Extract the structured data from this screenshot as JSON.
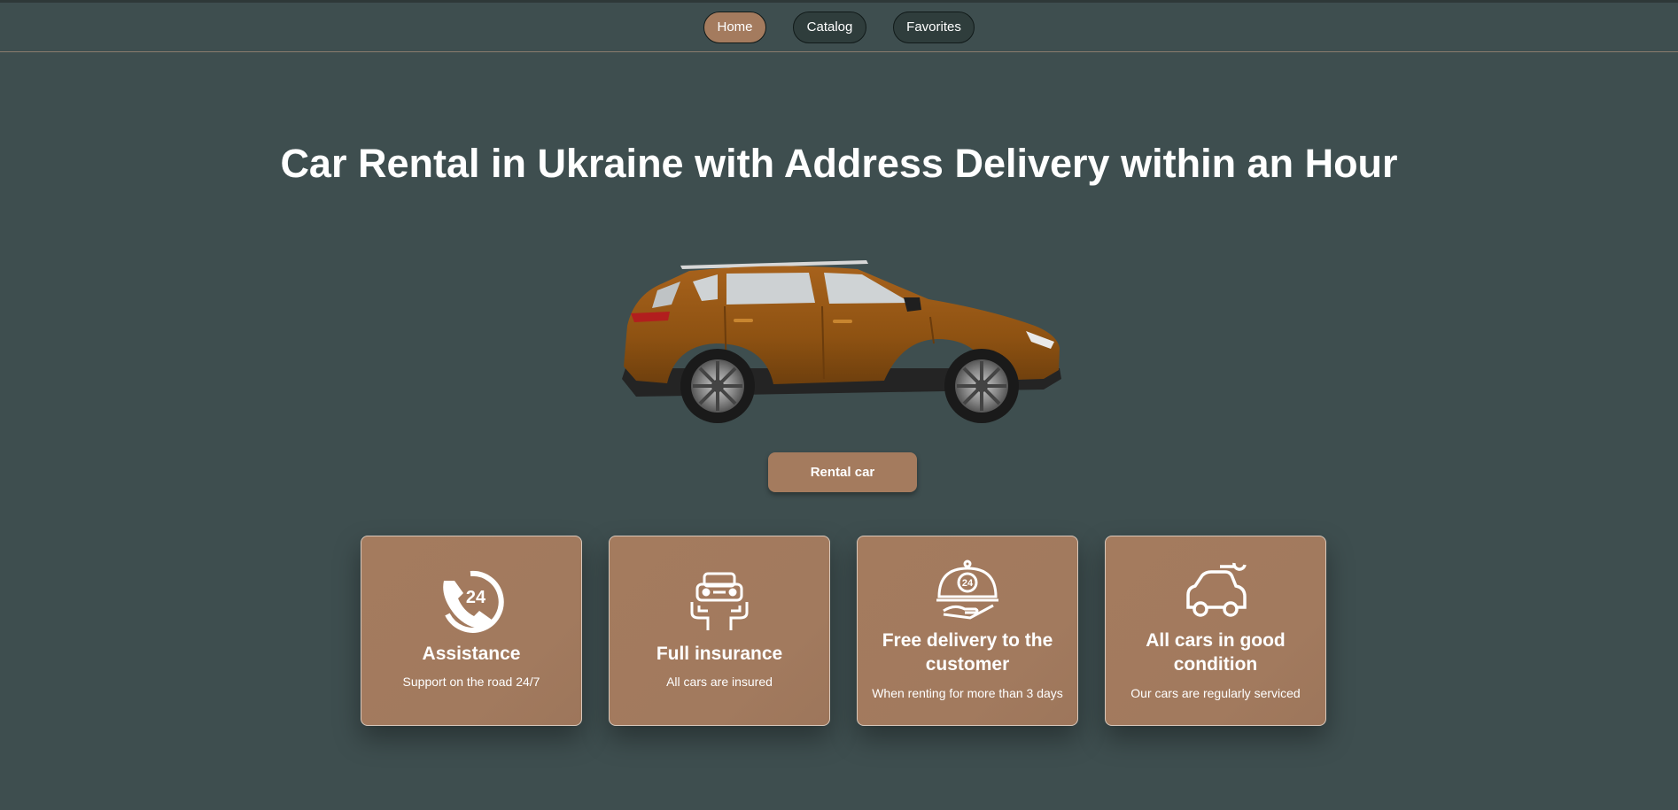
{
  "nav": {
    "items": [
      {
        "label": "Home",
        "active": true
      },
      {
        "label": "Catalog",
        "active": false
      },
      {
        "label": "Favorites",
        "active": false
      }
    ]
  },
  "hero": {
    "title": "Car Rental in Ukraine with Address Delivery within an Hour",
    "image": "orange-suv-side-view",
    "cta_label": "Rental car"
  },
  "features": [
    {
      "icon": "phone-24-icon",
      "title": "Assistance",
      "description": "Support on the road 24/7"
    },
    {
      "icon": "car-insurance-icon",
      "title": "Full insurance",
      "description": "All cars are insured"
    },
    {
      "icon": "delivery-cloche-icon",
      "title": "Free delivery to the customer",
      "description": "When renting for more than 3 days"
    },
    {
      "icon": "car-wrench-icon",
      "title": "All cars in good condition",
      "description": "Our cars are regularly serviced"
    }
  ],
  "colors": {
    "background": "#3e4e4f",
    "accent": "#a47b5e",
    "nav_button": "#2f3d3c",
    "text": "#ffffff"
  }
}
